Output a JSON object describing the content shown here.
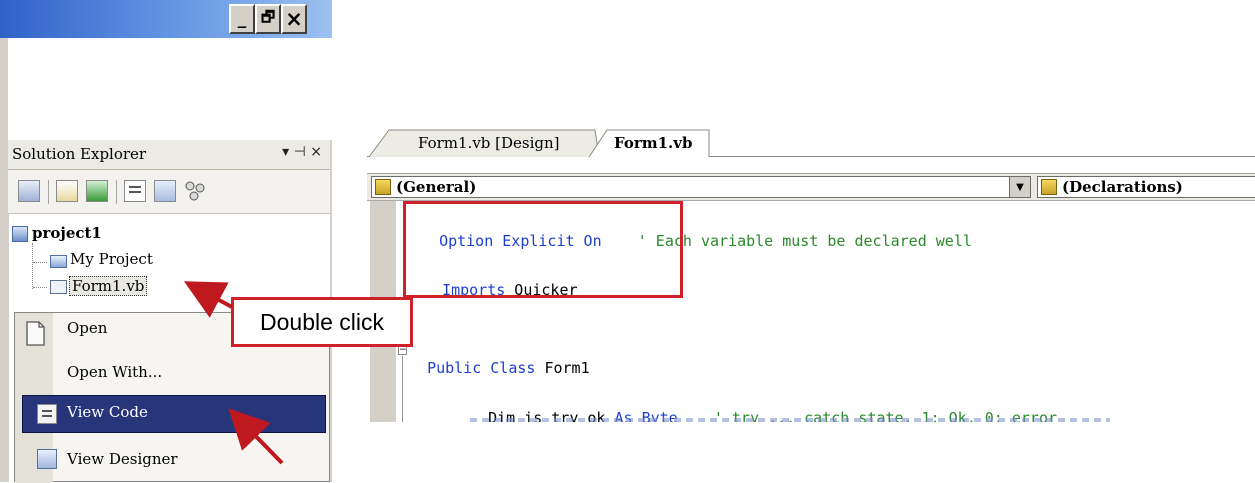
{
  "window": {
    "minimize_glyph": "_",
    "restore_glyph": "🗗",
    "close_glyph": "×"
  },
  "solution_explorer": {
    "title": "Solution Explorer",
    "header_glyphs": "▾ ⊣ ×",
    "toolbar_icons": [
      "properties-icon",
      "show-all-files-icon",
      "refresh-icon",
      "view-code-icon",
      "view-designer-icon",
      "class-diagram-icon"
    ],
    "tree": {
      "project": "project1",
      "items": [
        "My Project",
        "Form1.vb"
      ]
    }
  },
  "context_menu": {
    "items": [
      {
        "label": "Open",
        "icon": "open-file-icon"
      },
      {
        "label": "Open With...",
        "icon": ""
      },
      {
        "label": "View Code",
        "icon": "view-code-icon",
        "selected": true
      },
      {
        "label": "View Designer",
        "icon": "view-designer-icon"
      }
    ]
  },
  "editor": {
    "tabs": [
      "Form1.vb [Design]",
      "Form1.vb"
    ],
    "active_tab": "Form1.vb",
    "left_dropdown": "(General)",
    "right_dropdown": "(Declarations)",
    "code": {
      "line1_kw": "Option Explicit On",
      "line1_comment": "' Each variable must be declared well",
      "line2_kw": "Imports",
      "line2_rest": " Quicker",
      "line3_kw": "Public Class",
      "line3_rest": " Form1",
      "line4_pre": "Dim is_try_ok ",
      "line4_kw": "As Byte",
      "line4_comment": "' try ... catch state, 1: Ok, 0: error"
    }
  },
  "annotation": {
    "callout": "Double click",
    "highlight_color": "#d0202a",
    "arrow_color": "#c0181f"
  },
  "colors": {
    "keyword": "#1d3fd0",
    "comment": "#2a8a2a",
    "selection": "#27357a"
  }
}
